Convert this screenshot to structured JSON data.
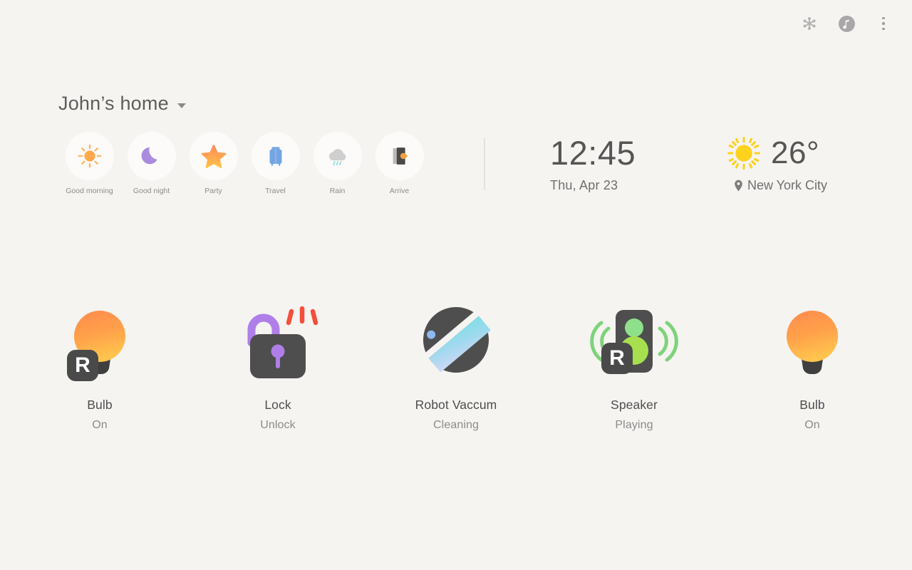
{
  "topbar": {
    "icons": [
      {
        "name": "snowflake-icon",
        "label": "Climate"
      },
      {
        "name": "music-note-icon",
        "label": "Music"
      },
      {
        "name": "overflow-menu-icon",
        "label": "More options"
      }
    ]
  },
  "header": {
    "home_name": "John’s home",
    "dropdown_icon": "chevron-down-icon"
  },
  "scenes": [
    {
      "label": "Good morning",
      "icon": "sun-icon"
    },
    {
      "label": "Good night",
      "icon": "moon-icon"
    },
    {
      "label": "Party",
      "icon": "star-icon"
    },
    {
      "label": "Travel",
      "icon": "suitcase-icon"
    },
    {
      "label": "Rain",
      "icon": "rain-cloud-icon"
    },
    {
      "label": "Arrive",
      "icon": "door-arrow-icon"
    }
  ],
  "clock": {
    "time": "12:45",
    "date": "Thu, Apr 23"
  },
  "weather": {
    "icon": "sun-icon",
    "temperature": "26°",
    "location_icon": "location-pin-icon",
    "location": "New York City"
  },
  "devices": [
    {
      "name": "Bulb",
      "state": "On",
      "icon": "light-bulb-icon",
      "badge": "R",
      "has_badge": true
    },
    {
      "name": "Lock",
      "state": "Unlock",
      "icon": "open-padlock-icon",
      "badge": "",
      "has_badge": false
    },
    {
      "name": "Robot Vaccum",
      "state": "Cleaning",
      "icon": "robot-vacuum-icon",
      "badge": "",
      "has_badge": false
    },
    {
      "name": "Speaker",
      "state": "Playing",
      "icon": "speaker-icon",
      "badge": "R",
      "has_badge": true
    },
    {
      "name": "Bulb",
      "state": "On",
      "icon": "light-bulb-icon",
      "badge": "",
      "has_badge": false
    }
  ],
  "colors": {
    "background": "#f5f4f1",
    "scene_circle": "#fcfbfa",
    "bulb_top": "#ff9a4d",
    "bulb_bottom": "#ffc44d",
    "dark_body": "#474747",
    "lock_purple": "#b07ee8",
    "alert_red": "#f44336",
    "speaker_green": "#9bdd4f",
    "vacuum_blue": "#7fd4e8",
    "sun_yellow": "#ffd21e",
    "text_primary": "#4e4e4e",
    "text_secondary": "#8b8b8b"
  }
}
